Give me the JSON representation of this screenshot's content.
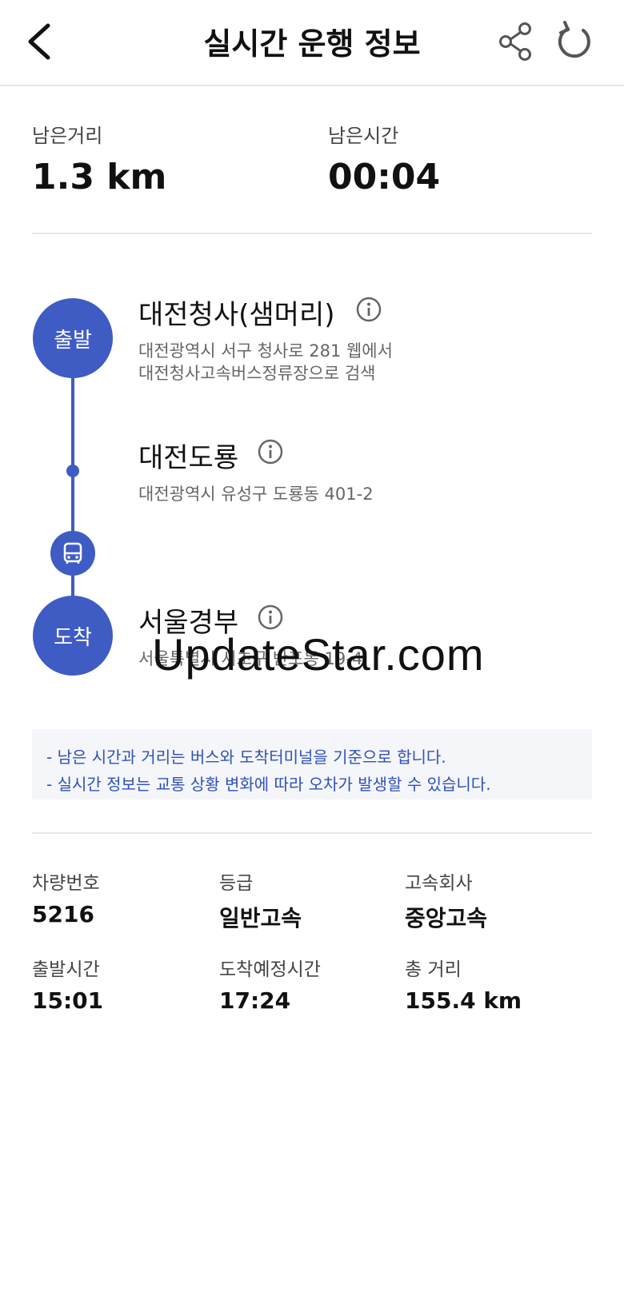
{
  "header": {
    "title": "실시간 운행 정보"
  },
  "summary": {
    "distance_label": "남은거리",
    "distance_value": "1.3 km",
    "time_label": "남은시간",
    "time_value": "00:04"
  },
  "route": {
    "departure_badge": "출발",
    "arrival_badge": "도착",
    "stops": [
      {
        "name": "대전청사(샘머리)",
        "address_line1": "대전광역시 서구 청사로 281 웹에서",
        "address_line2": "대전청사고속버스정류장으로 검색"
      },
      {
        "name": "대전도룡",
        "address_line1": "대전광역시 유성구 도룡동 401-2"
      },
      {
        "name": "서울경부",
        "address_line1": "서울특별시 서초구 반포동 19-4"
      }
    ]
  },
  "watermark": "UpdateStar.com",
  "notice": {
    "line1": "- 남은 시간과 거리는 버스와 도착터미널을 기준으로 합니다.",
    "line2": "- 실시간 정보는 교통 상황 변화에 따라 오차가 발생할 수 있습니다."
  },
  "bus_info": {
    "vehicle_label": "차량번호",
    "vehicle_value": "5216",
    "grade_label": "등급",
    "grade_value": "일반고속",
    "company_label": "고속회사",
    "company_value": "중앙고속",
    "departure_label": "출발시간",
    "departure_value": "15:01",
    "eta_label": "도착예정시간",
    "eta_value": "17:24",
    "distance_label": "총 거리",
    "distance_value": "155.4 km"
  },
  "colors": {
    "accent": "#3f5cc4",
    "notice_text": "#3050b8",
    "notice_bg": "#f4f6f9"
  },
  "icons": {
    "back": "chevron-left-icon",
    "share": "share-icon",
    "refresh": "refresh-icon",
    "info": "info-icon",
    "bus": "bus-icon"
  }
}
